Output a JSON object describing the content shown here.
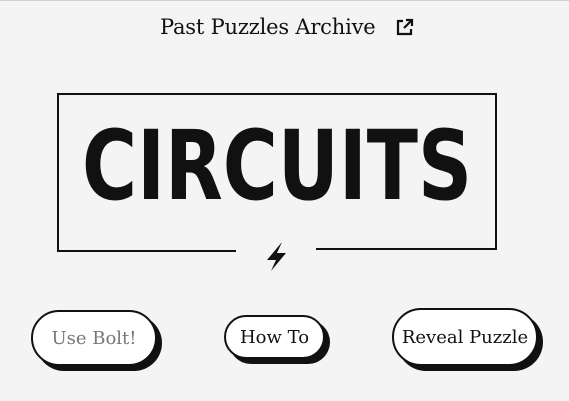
{
  "header": {
    "archive_link_label": "Past Puzzles Archive",
    "external_icon": "external-link-icon"
  },
  "logo": {
    "wordmark": "CIRCUITS",
    "bolt_icon": "lightning-bolt-icon"
  },
  "actions": {
    "use_bolt_label": "Use Bolt!",
    "how_to_label": "How To",
    "reveal_label": "Reveal Puzzle"
  },
  "colors": {
    "background": "#f4f4f4",
    "ink": "#111111",
    "disabled_text": "#777777",
    "button_fill": "#ffffff"
  }
}
